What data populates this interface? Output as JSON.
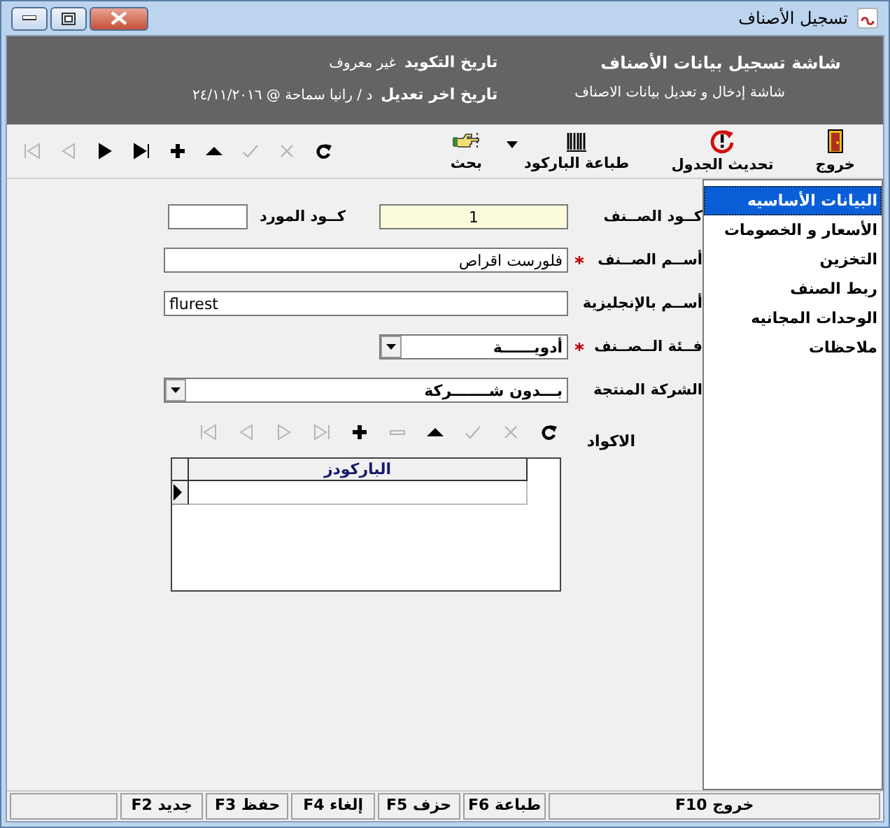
{
  "window": {
    "title": "تسجيل الأصناف"
  },
  "header": {
    "title": "شاشة تسجيل بيانات الأصناف",
    "subtitle": "شاشة إدخال و تعديل بيانات الاصناف",
    "info": [
      {
        "label": "تاريخ التكويد",
        "value": "غير معروف"
      },
      {
        "label": "تاريخ اخر تعديل",
        "value": "د / رانيا سماحة @ ٢٤/١١/٢٠١٦"
      }
    ]
  },
  "toolbar": {
    "buttons": [
      {
        "kind": "exit",
        "label": "خروج",
        "dropdown": false
      },
      {
        "kind": "refresh",
        "label": "تحديث الجدول",
        "dropdown": false
      },
      {
        "kind": "barcode",
        "label": "طباعة الباركود",
        "dropdown": true
      },
      {
        "kind": "search",
        "label": "بحث",
        "dropdown": false
      }
    ],
    "nav": [
      {
        "kind": "refresh",
        "disabled": false
      },
      {
        "kind": "cancel",
        "disabled": true
      },
      {
        "kind": "confirm",
        "disabled": true
      },
      {
        "kind": "up",
        "disabled": false
      },
      {
        "kind": "add",
        "disabled": false
      },
      {
        "kind": "last",
        "disabled": false
      },
      {
        "kind": "next",
        "disabled": false
      },
      {
        "kind": "prev",
        "disabled": true
      },
      {
        "kind": "first",
        "disabled": true
      }
    ]
  },
  "form": {
    "item_code": {
      "label": "كــود الصــنف",
      "value": "1"
    },
    "supplier_code": {
      "label": "كــود المورد"
    },
    "fields": [
      {
        "kind": "text",
        "label": "أســم الصــنف",
        "required": true,
        "value": "فلورست اقراص",
        "wide": true
      },
      {
        "kind": "text",
        "label": "أســم بالإنجليزية",
        "required": false,
        "value": "flurest",
        "wide": true
      },
      {
        "kind": "select",
        "label": "فــئة الــصــنف",
        "required": true,
        "value": "أدويــــــة",
        "wide": false
      },
      {
        "kind": "select",
        "label": "الشركة المنتجة",
        "required": false,
        "value": "بـــدون شـــــــركة",
        "wide": true
      }
    ],
    "codes": {
      "label": "الاكواد",
      "nav": [
        {
          "kind": "refresh",
          "disabled": false
        },
        {
          "kind": "cancel",
          "disabled": true
        },
        {
          "kind": "confirm",
          "disabled": true
        },
        {
          "kind": "up",
          "disabled": false
        },
        {
          "kind": "remove",
          "disabled": true
        },
        {
          "kind": "add",
          "disabled": false
        },
        {
          "kind": "last",
          "disabled": true
        },
        {
          "kind": "next",
          "disabled": true
        },
        {
          "kind": "prev",
          "disabled": true
        },
        {
          "kind": "first",
          "disabled": true
        }
      ],
      "grid": {
        "columns": [
          "الباركودز"
        ]
      }
    }
  },
  "sidebar": {
    "items": [
      {
        "label": "البيانات الأساسيه",
        "selected": true
      },
      {
        "label": "الأسعار و الخصومات",
        "selected": false
      },
      {
        "label": "التخزين",
        "selected": false
      },
      {
        "label": "ربط الصنف",
        "selected": false
      },
      {
        "label": "الوحدات المجانيه",
        "selected": false
      },
      {
        "label": "ملاحظات",
        "selected": false
      }
    ]
  },
  "status_bar": [
    "خروج F10",
    "طباعة F6",
    "حزف F5",
    "إلغاء F4",
    "حفظ F3",
    "جديد F2"
  ]
}
